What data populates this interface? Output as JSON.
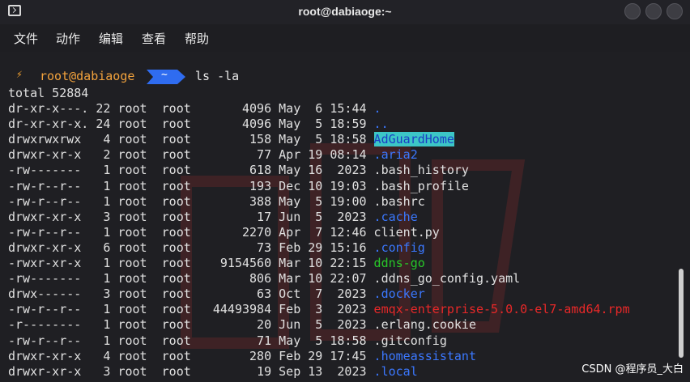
{
  "window": {
    "title": "root@dabiaoge:~"
  },
  "menu": [
    "文件",
    "动作",
    "编辑",
    "查看",
    "帮助"
  ],
  "prompt": {
    "bolt": "⚡",
    "user_host": "root@dabiaoge",
    "dir": "~",
    "command": "ls -la"
  },
  "total_line": "total 52884",
  "entries": [
    {
      "perm": "dr-xr-x---.",
      "links": "22",
      "owner": "root",
      "group": "root",
      "size": "4096",
      "month": "May",
      "day": "6",
      "time": "15:44",
      "name": ".",
      "type": "dir"
    },
    {
      "perm": "dr-xr-xr-x.",
      "links": "24",
      "owner": "root",
      "group": "root",
      "size": "4096",
      "month": "May",
      "day": "5",
      "time": "18:59",
      "name": "..",
      "type": "dir"
    },
    {
      "perm": "drwxrwxrwx",
      "links": "4",
      "owner": "root",
      "group": "root",
      "size": "158",
      "month": "May",
      "day": "5",
      "time": "18:58",
      "name": "AdGuardHome",
      "type": "dir-highlight"
    },
    {
      "perm": "drwxr-xr-x",
      "links": "2",
      "owner": "root",
      "group": "root",
      "size": "77",
      "month": "Apr",
      "day": "19",
      "time": "08:14",
      "name": ".aria2",
      "type": "dir"
    },
    {
      "perm": "-rw-------",
      "links": "1",
      "owner": "root",
      "group": "root",
      "size": "618",
      "month": "May",
      "day": "16",
      "time": "2023",
      "name": ".bash_history",
      "type": "file"
    },
    {
      "perm": "-rw-r--r--",
      "links": "1",
      "owner": "root",
      "group": "root",
      "size": "193",
      "month": "Dec",
      "day": "10",
      "time": "19:03",
      "name": ".bash_profile",
      "type": "file"
    },
    {
      "perm": "-rw-r--r--",
      "links": "1",
      "owner": "root",
      "group": "root",
      "size": "388",
      "month": "May",
      "day": "5",
      "time": "19:00",
      "name": ".bashrc",
      "type": "file"
    },
    {
      "perm": "drwxr-xr-x",
      "links": "3",
      "owner": "root",
      "group": "root",
      "size": "17",
      "month": "Jun",
      "day": "5",
      "time": "2023",
      "name": ".cache",
      "type": "dir"
    },
    {
      "perm": "-rw-r--r--",
      "links": "1",
      "owner": "root",
      "group": "root",
      "size": "2270",
      "month": "Apr",
      "day": "7",
      "time": "12:46",
      "name": "client.py",
      "type": "file"
    },
    {
      "perm": "drwxr-xr-x",
      "links": "6",
      "owner": "root",
      "group": "root",
      "size": "73",
      "month": "Feb",
      "day": "29",
      "time": "15:16",
      "name": ".config",
      "type": "dir"
    },
    {
      "perm": "-rwxr-xr-x",
      "links": "1",
      "owner": "root",
      "group": "root",
      "size": "9154560",
      "month": "Mar",
      "day": "10",
      "time": "22:15",
      "name": "ddns-go",
      "type": "exec"
    },
    {
      "perm": "-rw-------",
      "links": "1",
      "owner": "root",
      "group": "root",
      "size": "806",
      "month": "Mar",
      "day": "10",
      "time": "22:07",
      "name": ".ddns_go_config.yaml",
      "type": "file"
    },
    {
      "perm": "drwx------",
      "links": "3",
      "owner": "root",
      "group": "root",
      "size": "63",
      "month": "Oct",
      "day": "7",
      "time": "2023",
      "name": ".docker",
      "type": "dir"
    },
    {
      "perm": "-rw-r--r--",
      "links": "1",
      "owner": "root",
      "group": "root",
      "size": "44493984",
      "month": "Feb",
      "day": "3",
      "time": "2023",
      "name": "emqx-enterprise-5.0.0-el7-amd64.rpm",
      "type": "archive"
    },
    {
      "perm": "-r--------",
      "links": "1",
      "owner": "root",
      "group": "root",
      "size": "20",
      "month": "Jun",
      "day": "5",
      "time": "2023",
      "name": ".erlang.cookie",
      "type": "file"
    },
    {
      "perm": "-rw-r--r--",
      "links": "1",
      "owner": "root",
      "group": "root",
      "size": "71",
      "month": "May",
      "day": "5",
      "time": "18:58",
      "name": ".gitconfig",
      "type": "file"
    },
    {
      "perm": "drwxr-xr-x",
      "links": "4",
      "owner": "root",
      "group": "root",
      "size": "280",
      "month": "Feb",
      "day": "29",
      "time": "17:45",
      "name": ".homeassistant",
      "type": "dir"
    },
    {
      "perm": "drwxr-xr-x",
      "links": "3",
      "owner": "root",
      "group": "root",
      "size": "19",
      "month": "Sep",
      "day": "13",
      "time": "2023",
      "name": ".local",
      "type": "dir"
    }
  ],
  "watermark": "CSDN @程序员_大白",
  "colors": {
    "dir": "#3b78ff",
    "exec": "#28c828",
    "archive": "#e82828",
    "highlight_bg": "#3cc6c6",
    "prompt": "#f2a23c",
    "dir_segment": "#2f6cf0"
  }
}
